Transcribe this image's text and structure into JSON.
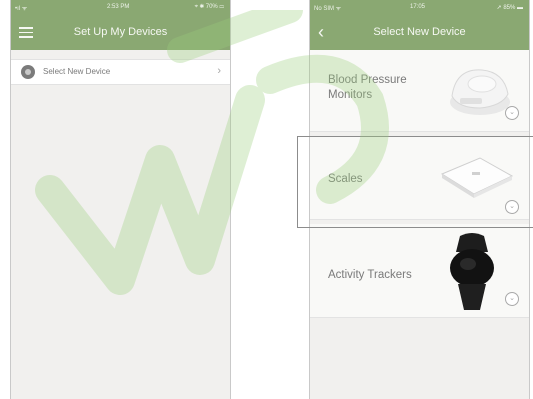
{
  "left_screen": {
    "status": {
      "carrier": "•ıl ᯤ",
      "time": "2:53 PM",
      "battery": "⌖ ✱ 70% ▭"
    },
    "header": {
      "title": "Set Up My Devices"
    },
    "list": [
      {
        "label": "Select New Device",
        "chevron": "›"
      }
    ]
  },
  "right_screen": {
    "status": {
      "carrier": "No SIM ᯤ",
      "time": "17:05",
      "battery": "➚ 85% ▬"
    },
    "header": {
      "title": "Select New Device",
      "back": "‹"
    },
    "devices": [
      {
        "label": "Blood Pressure Monitors",
        "expand": "⌄",
        "icon": "blood-pressure-monitor-image"
      },
      {
        "label": "Scales",
        "expand": "⌄",
        "icon": "scale-image"
      },
      {
        "label": "Activity Trackers",
        "expand": "⌄",
        "icon": "activity-tracker-image"
      }
    ]
  },
  "colors": {
    "header": "#8aa872",
    "background": "#f1f0ee",
    "card": "#f9f9f7",
    "watermark": "#9ccf7e"
  }
}
